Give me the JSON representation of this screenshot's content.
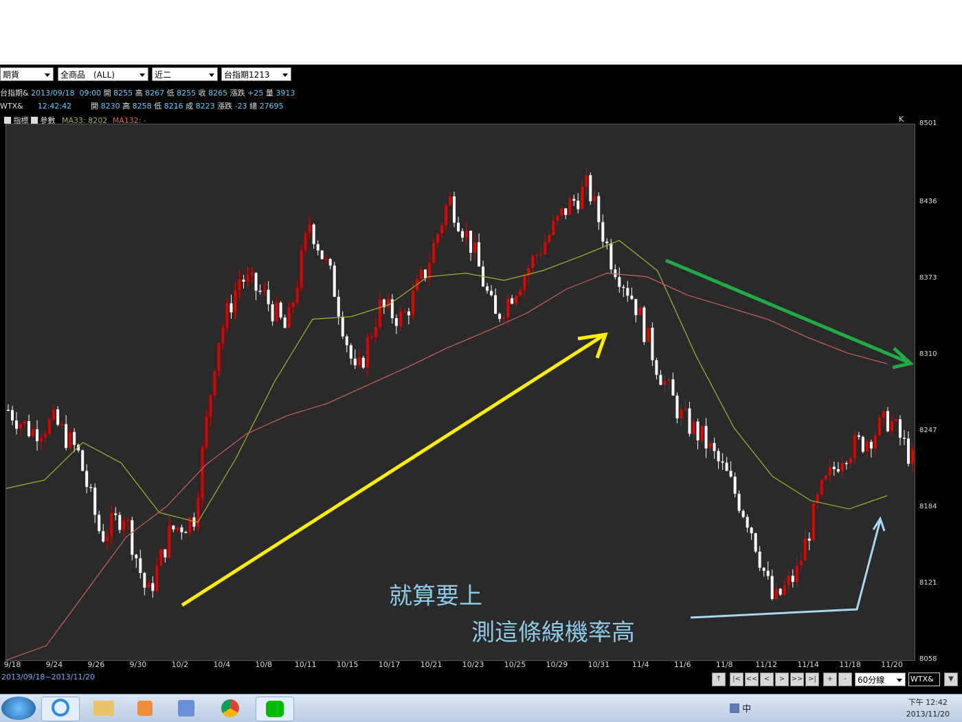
{
  "toolbar": {
    "market": "期貨",
    "product": "全商品　(ALL)",
    "month": "近二",
    "contract": "台指期1213"
  },
  "quotes": [
    {
      "name": "台指期&",
      "time": "2013/09/18  09:00",
      "open_l": "開",
      "open": "8255",
      "high_l": "高",
      "high": "8267",
      "low_l": "低",
      "low": "8255",
      "close_l": "收",
      "close": "8265",
      "chg_l": "漲跌",
      "chg": "+25",
      "vol_l": "量",
      "vol": "3913"
    },
    {
      "name": "WTX&",
      "time": "12:42:42",
      "open_l": "開",
      "open": "8230",
      "high_l": "高",
      "high": "8258",
      "low_l": "低",
      "low": "8216",
      "close_l": "成",
      "close": "8223",
      "chg_l": "漲跌",
      "chg": "-23",
      "vol_l": "總",
      "vol": "27695"
    }
  ],
  "indicator_bar": {
    "indicator": "指標",
    "params": "參數",
    "ma33": "MA33: 8202",
    "ma132": "MA132: -",
    "kline": "K線"
  },
  "range_label": "2013/09/18~2013/11/20",
  "period_select": "60分線",
  "symbol_box": "WTX&",
  "nav_buttons": [
    "|<",
    "<<",
    "<",
    ">",
    ">>",
    ">|",
    "+",
    "-"
  ],
  "annotations": {
    "line1": "就算要上",
    "line2": "測這條線機率高"
  },
  "clock": {
    "ampm_time": "下午 12:42",
    "date": "2013/11/20"
  },
  "tray": {
    "ime": "中"
  },
  "colors": {
    "up": "#e00000",
    "down": "#ffffff",
    "ma33": "#a8b42a",
    "ma132": "#d06060",
    "arrow_up": "#ffee00",
    "arrow_down": "#22aa44",
    "arrow_note": "#a8d8f0"
  },
  "chart_data": {
    "type": "line",
    "title": "",
    "ylim": [
      8058,
      8501
    ],
    "yticks": [
      "8501",
      "8436",
      "8373",
      "8310",
      "8247",
      "8184",
      "8121",
      "8058"
    ],
    "xticks": [
      "9/18",
      "9/24",
      "9/26",
      "9/30",
      "10/2",
      "10/4",
      "10/8",
      "10/11",
      "10/15",
      "10/17",
      "10/21",
      "10/23",
      "10/25",
      "10/29",
      "10/31",
      "11/4",
      "11/6",
      "11/8",
      "11/12",
      "11/14",
      "11/18",
      "11/20"
    ],
    "series": [
      {
        "name": "MA33",
        "values": [
          8200,
          8207,
          8238,
          8221,
          8180,
          8172,
          8225,
          8288,
          8340,
          8342,
          8352,
          8375,
          8378,
          8372,
          8380,
          8392,
          8405,
          8380,
          8310,
          8250,
          8210,
          8190,
          8183,
          8194
        ]
      },
      {
        "name": "MA132",
        "values": [
          8058,
          8070,
          8115,
          8160,
          8185,
          8220,
          8245,
          8260,
          8270,
          8285,
          8300,
          8316,
          8330,
          8345,
          8365,
          8378,
          8375,
          8360,
          8350,
          8340,
          8325,
          8312,
          8303
        ]
      },
      {
        "name": "Price",
        "values": [
          8265,
          8247,
          8255,
          8230,
          8160,
          8180,
          8110,
          8165,
          8175,
          8320,
          8375,
          8360,
          8330,
          8420,
          8370,
          8290,
          8350,
          8340,
          8380,
          8440,
          8400,
          8340,
          8370,
          8400,
          8430,
          8450,
          8390,
          8355,
          8300,
          8260,
          8240,
          8210,
          8170,
          8105,
          8130,
          8195,
          8230,
          8240,
          8258,
          8223
        ]
      }
    ]
  }
}
